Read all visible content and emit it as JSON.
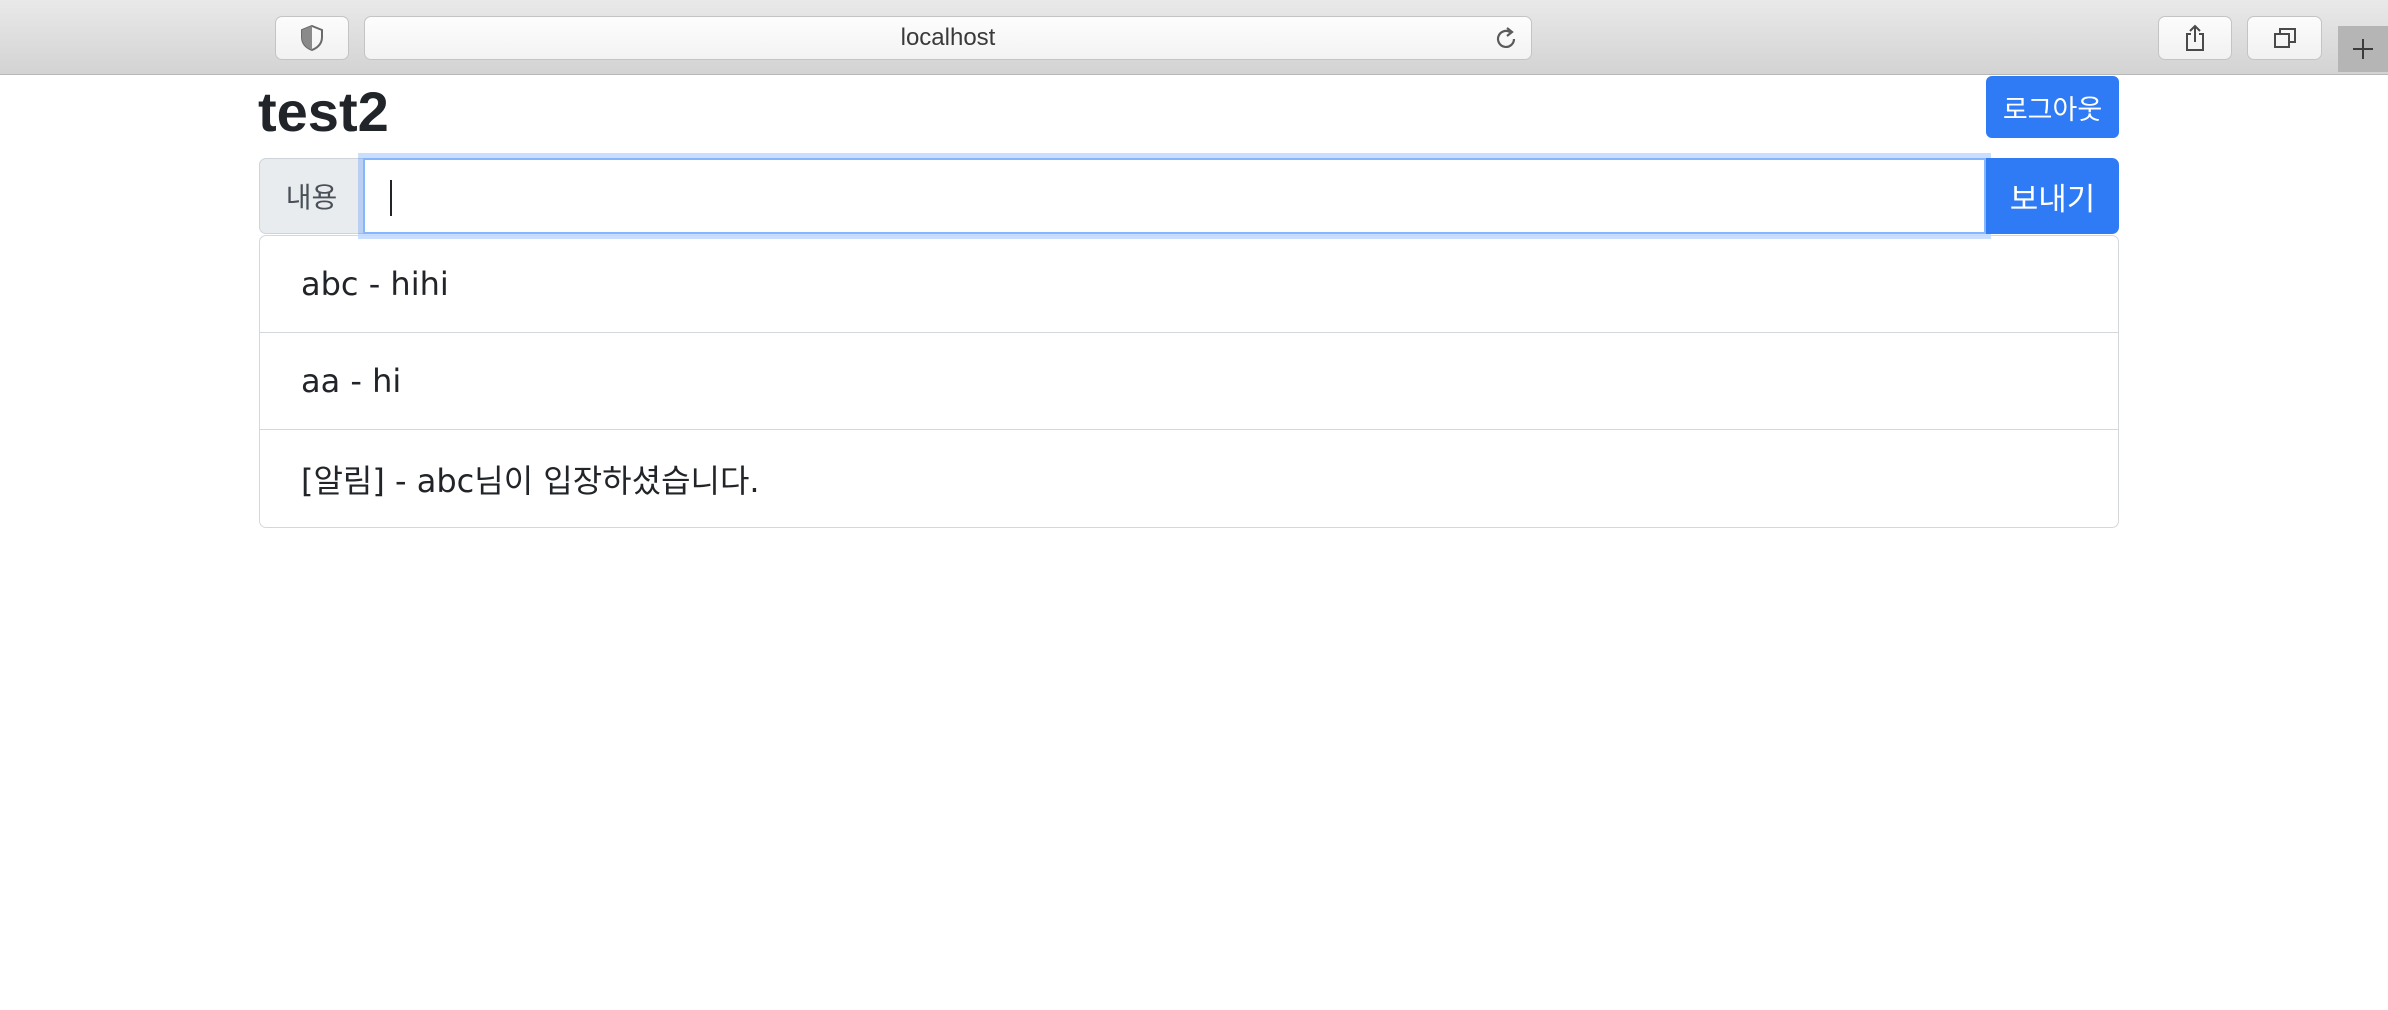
{
  "browser": {
    "address": "localhost",
    "icons": {
      "privacy": "shield-icon",
      "reload": "reload-icon",
      "share": "share-icon",
      "tabs": "tabs-overview-icon",
      "new_tab": "plus-icon"
    }
  },
  "header": {
    "title": "test2",
    "logout_label": "로그아웃"
  },
  "composer": {
    "label": "내용",
    "input_value": "",
    "send_label": "보내기"
  },
  "messages": [
    {
      "text": "abc - hihi"
    },
    {
      "text": "aa - hi"
    },
    {
      "text": "[알림] - abc님이 입장하셨습니다."
    }
  ],
  "colors": {
    "primary": "#2f7bf5",
    "focus_ring": "#86b7fe",
    "label_bg": "#e9ecef"
  }
}
